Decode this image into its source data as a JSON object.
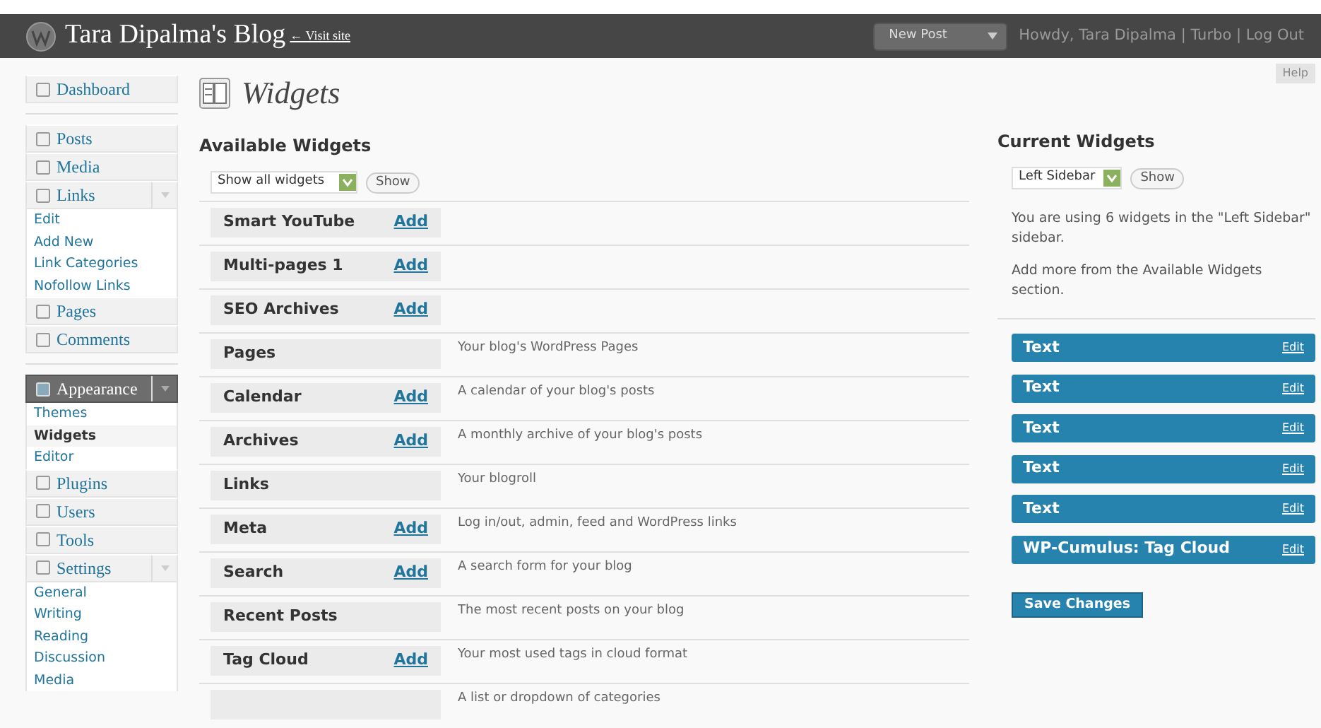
{
  "header": {
    "site_title": "Tara Dipalma's Blog",
    "visit_link": "← Visit site",
    "new_post_button": "New Post",
    "greeting": "Howdy,",
    "user_link": "Tara Dipalma",
    "links": [
      {
        "divider": "|",
        "label": "Turbo"
      },
      {
        "divider": "|",
        "label": "Log Out"
      }
    ]
  },
  "help_button": "Help",
  "sidebar": {
    "items": [
      {
        "label": "Dashboard",
        "kind": "item",
        "selected": false
      },
      {
        "kind": "separator"
      },
      {
        "label": "Posts",
        "kind": "item",
        "selected": false
      },
      {
        "label": "Media",
        "kind": "item",
        "selected": false
      },
      {
        "label": "Links",
        "kind": "item",
        "selected": false,
        "expanded": true,
        "children": [
          {
            "label": "Edit",
            "selected": false
          },
          {
            "label": "Add New",
            "selected": false
          },
          {
            "label": "Link Categories",
            "selected": false
          },
          {
            "label": "Nofollow Links",
            "selected": false
          }
        ]
      },
      {
        "label": "Pages",
        "kind": "item",
        "selected": false
      },
      {
        "label": "Comments",
        "kind": "item",
        "selected": false
      },
      {
        "kind": "separator"
      },
      {
        "label": "Appearance",
        "kind": "item",
        "selected": true,
        "expanded": true,
        "children": [
          {
            "label": "Themes",
            "selected": false
          },
          {
            "label": "Widgets",
            "selected": true
          },
          {
            "label": "Editor",
            "selected": false
          }
        ]
      },
      {
        "label": "Plugins",
        "kind": "item",
        "selected": false
      },
      {
        "label": "Users",
        "kind": "item",
        "selected": false
      },
      {
        "label": "Tools",
        "kind": "item",
        "selected": false
      },
      {
        "label": "Settings",
        "kind": "item",
        "selected": false,
        "expanded": true,
        "children": [
          {
            "label": "General",
            "selected": false
          },
          {
            "label": "Writing",
            "selected": false
          },
          {
            "label": "Reading",
            "selected": false
          },
          {
            "label": "Discussion",
            "selected": false
          },
          {
            "label": "Media",
            "selected": false
          }
        ]
      }
    ]
  },
  "page_title": "Widgets",
  "available": {
    "heading": "Available Widgets",
    "filter_value": "Show all widgets",
    "show_button": "Show",
    "widgets": [
      {
        "name": "Smart YouTube",
        "action": "Add"
      },
      {
        "name": "Multi-pages 1",
        "action": "Add"
      },
      {
        "name": "SEO Archives",
        "action": "Add"
      },
      {
        "name": "Pages",
        "description": "Your blog's WordPress Pages"
      },
      {
        "name": "Calendar",
        "action": "Add",
        "description": "A calendar of your blog's posts"
      },
      {
        "name": "Archives",
        "action": "Add",
        "description": "A monthly archive of your blog's posts"
      },
      {
        "name": "Links",
        "description": "Your blogroll"
      },
      {
        "name": "Meta",
        "action": "Add",
        "description": "Log in/out, admin, feed and WordPress links"
      },
      {
        "name": "Search",
        "action": "Add",
        "description": "A search form for your blog"
      },
      {
        "name": "Recent Posts",
        "description": "The most recent posts on your blog"
      },
      {
        "name": "Tag Cloud",
        "action": "Add",
        "description": "Your most used tags in cloud format"
      },
      {
        "description": "A list or dropdown of categories"
      }
    ]
  },
  "current": {
    "heading": "Current Widgets",
    "sidebar_value": "Left Sidebar",
    "show_button": "Show",
    "info": [
      "You are using 6 widgets in the \"Left Sidebar\" sidebar.",
      "Add more from the Available Widgets section."
    ],
    "widgets": [
      {
        "name": "Text",
        "action": "Edit"
      },
      {
        "name": "Text",
        "action": "Edit"
      },
      {
        "name": "Text",
        "action": "Edit"
      },
      {
        "name": "Text",
        "action": "Edit"
      },
      {
        "name": "Text",
        "action": "Edit"
      },
      {
        "name": "WP-Cumulus: Tag Cloud",
        "action": "Edit"
      }
    ],
    "save_button": "Save Changes"
  }
}
